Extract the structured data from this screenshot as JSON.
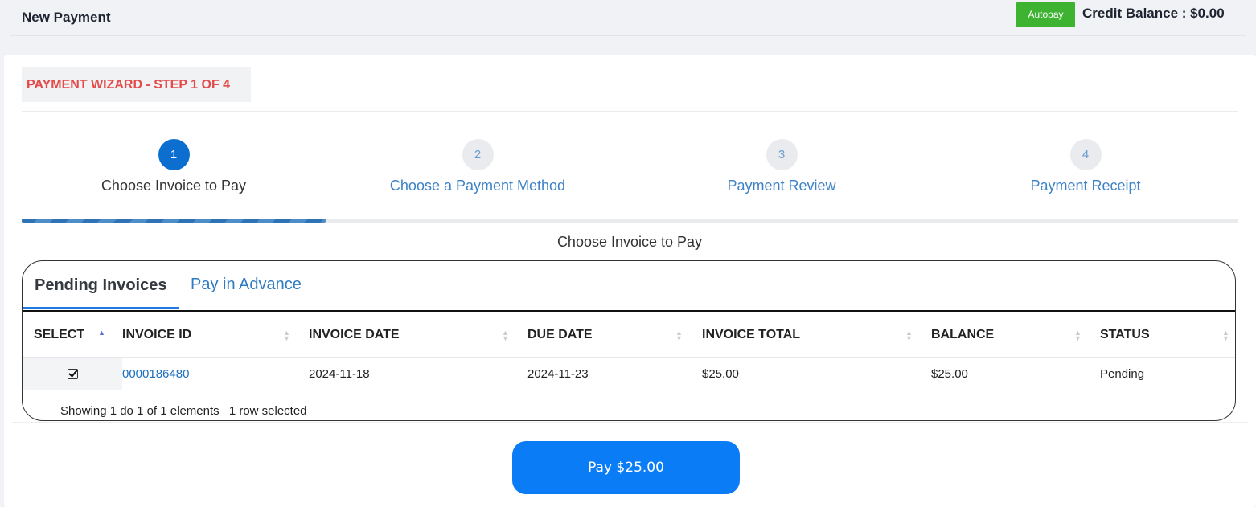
{
  "header": {
    "title": "New Payment",
    "autopay_label": "Autopay",
    "credit_balance": "Credit Balance : $0.00"
  },
  "wizard": {
    "title": "PAYMENT WIZARD - STEP 1 OF 4",
    "steps": [
      {
        "number": "1",
        "label": "Choose Invoice to Pay",
        "active": true
      },
      {
        "number": "2",
        "label": "Choose a Payment Method",
        "active": false
      },
      {
        "number": "3",
        "label": "Payment Review",
        "active": false
      },
      {
        "number": "4",
        "label": "Payment Receipt",
        "active": false
      }
    ],
    "progress_fraction": 0.25,
    "section_title": "Choose Invoice to Pay"
  },
  "tabs": {
    "pending": "Pending Invoices",
    "advance": "Pay in Advance"
  },
  "table": {
    "headers": {
      "select": "SELECT",
      "invoice_id": "INVOICE ID",
      "invoice_date": "INVOICE DATE",
      "due_date": "DUE DATE",
      "invoice_total": "INVOICE TOTAL",
      "balance": "BALANCE",
      "status": "STATUS"
    },
    "rows": [
      {
        "selected": true,
        "invoice_id": "0000186480",
        "invoice_date": "2024-11-18",
        "due_date": "2024-11-23",
        "invoice_total": "$25.00",
        "balance": "$25.00",
        "status": "Pending"
      }
    ],
    "info": "Showing 1 do 1 of 1 elements",
    "selection_info": "1 row selected"
  },
  "pay_button": "Pay $25.00",
  "colors": {
    "wizard_title": "#e44a4a",
    "active_step": "#0c6fd0",
    "autopay": "#3eb332",
    "pay_button": "#0a7cf5",
    "link": "#1e6fc0"
  },
  "icons": {
    "checkbox": "checkbox-checked-icon",
    "sort": "sort-arrows-icon"
  }
}
